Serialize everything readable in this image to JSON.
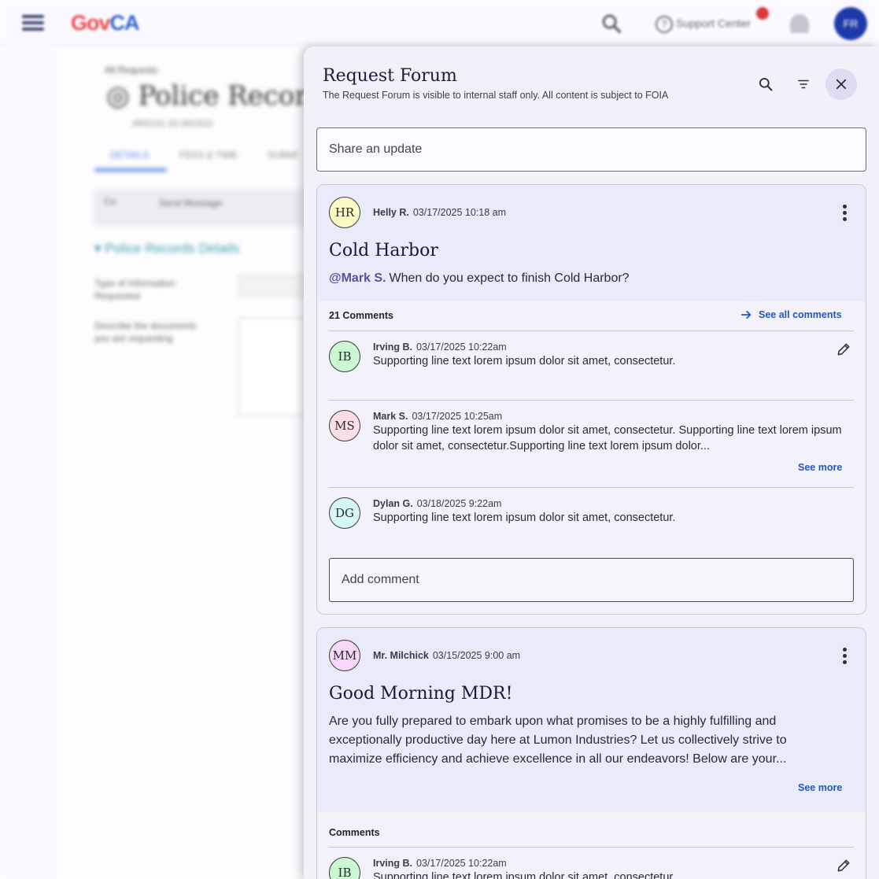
{
  "app": {
    "logo_gov": "Gov",
    "logo_ca": "CA",
    "support_label": "Support Center",
    "avatar_initials": "FR",
    "breadcrumb": "All Requests",
    "page_title": "Police Records",
    "page_subtitle": "#R0151 02-001522",
    "tabs": [
      "DETAILS",
      "FEES & TIME",
      "SUBMI"
    ],
    "toolbar_labels": [
      "Co",
      "Send Message"
    ],
    "section_title": "Police Records Details",
    "field1_label": "Type of Information Requested",
    "field2_label": "Describe the documents you are requesting"
  },
  "forum": {
    "title": "Request Forum",
    "subtitle": "The Request Forum is visible to internal staff only. All content is subject to FOIA",
    "share_placeholder": "Share an update",
    "add_comment_placeholder": "Add comment"
  },
  "posts": [
    {
      "initials": "HR",
      "author": "Helly R.",
      "timestamp": "03/17/2025 10:18 am",
      "title": "Cold Harbor",
      "mention": "@Mark S.",
      "body": "When do you expect to finish Cold Harbor?",
      "comments_heading": "21 Comments",
      "see_all_label": "See all comments",
      "comments": [
        {
          "initials": "IB",
          "author": "Irving B.",
          "timestamp": "03/17/2025 10:22am",
          "text": "Supporting line text lorem ipsum dolor sit amet, consectetur."
        },
        {
          "initials": "MS",
          "author": "Mark S.",
          "timestamp": "03/17/2025 10:25am",
          "text": "Supporting line text lorem ipsum dolor sit amet, consectetur. Supporting line text lorem ipsum dolor sit amet, consectetur.Supporting line text lorem ipsum dolor...",
          "see_more": "See more"
        },
        {
          "initials": "DG",
          "author": "Dylan G.",
          "timestamp": "03/18/2025 9:22am",
          "text": "Supporting line text lorem ipsum dolor sit amet, consectetur."
        }
      ]
    },
    {
      "initials": "MM",
      "author": "Mr. Milchick",
      "timestamp": "03/15/2025 9:00 am",
      "title": "Good Morning MDR!",
      "body": "Are you fully prepared to embark upon what promises to be a highly fulfilling and exceptionally productive day here at Lumon Industries? Let us collectively strive to maximize efficiency and achieve excellence in all our endeavors! Below are your...",
      "see_more": "See more",
      "comments_heading": "Comments",
      "comments": [
        {
          "initials": "IB",
          "author": "Irving B.",
          "timestamp": "03/17/2025 10:22am",
          "text": "Supporting line text lorem ipsum dolor sit amet, consectetur."
        }
      ]
    }
  ],
  "colors": {
    "panel_bg": "#f2f1fa",
    "post_header_bg": "#e9ebfb",
    "link_blue": "#1f57c3",
    "mention_purple": "#5b4fa0",
    "close_button_bg": "#dddcf2"
  },
  "icons": [
    "menu-icon",
    "search-icon",
    "help-icon",
    "bell-icon",
    "filter-icon",
    "close-icon",
    "more-vert-icon",
    "arrow-right-icon",
    "edit-pencil-icon"
  ]
}
